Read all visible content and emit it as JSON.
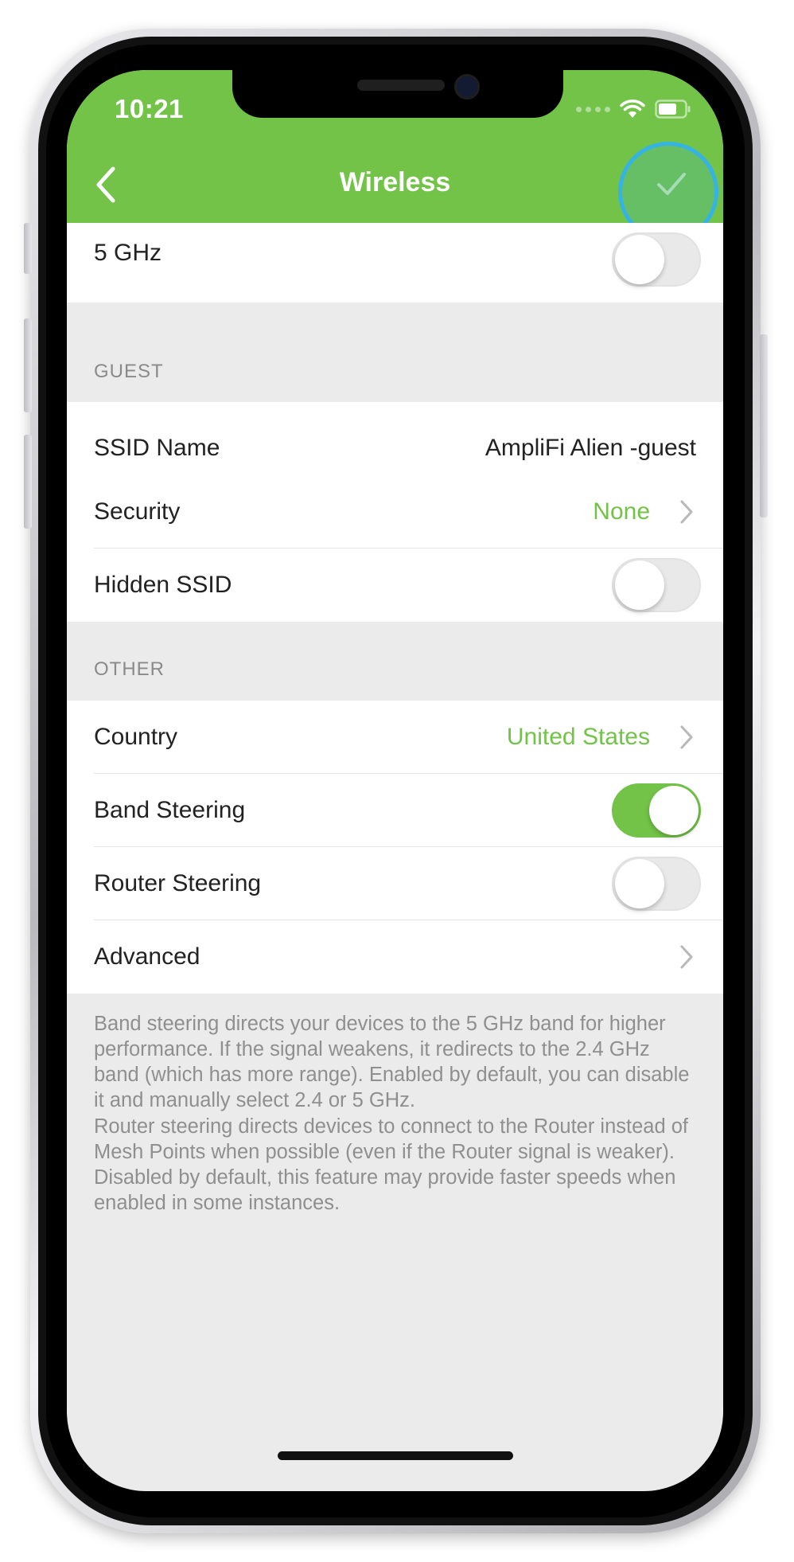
{
  "status_bar": {
    "time": "10:21"
  },
  "nav": {
    "title": "Wireless",
    "back_icon": "chevron-left-icon",
    "confirm_icon": "checkmark-icon"
  },
  "top_row": {
    "label": "5 GHz",
    "toggle": "off"
  },
  "guest": {
    "header": "GUEST",
    "rows": [
      {
        "label": "SSID Name",
        "value": "AmpliFi Alien -guest"
      },
      {
        "label": "Security",
        "value": "None"
      },
      {
        "label": "Hidden SSID",
        "toggle": "off"
      }
    ]
  },
  "other": {
    "header": "OTHER",
    "rows": [
      {
        "label": "Country",
        "value": "United States"
      },
      {
        "label": "Band Steering",
        "toggle": "on"
      },
      {
        "label": "Router Steering",
        "toggle": "off"
      },
      {
        "label": "Advanced"
      }
    ]
  },
  "footnotes": {
    "band_steering": "Band steering directs your devices to the 5 GHz band for higher performance. If the signal weakens, it redirects to the 2.4 GHz band (which has more range). Enabled by default, you can disable it and manually select 2.4 or 5 GHz.",
    "router_steering": "Router steering directs devices to connect to the Router instead of Mesh Points when possible (even if the Router signal is weaker). Disabled by default, this feature may provide faster speeds when enabled in some instances."
  },
  "colors": {
    "accent": "#72c348",
    "tap_highlight": "#34b3e4",
    "background": "#ebebeb"
  }
}
